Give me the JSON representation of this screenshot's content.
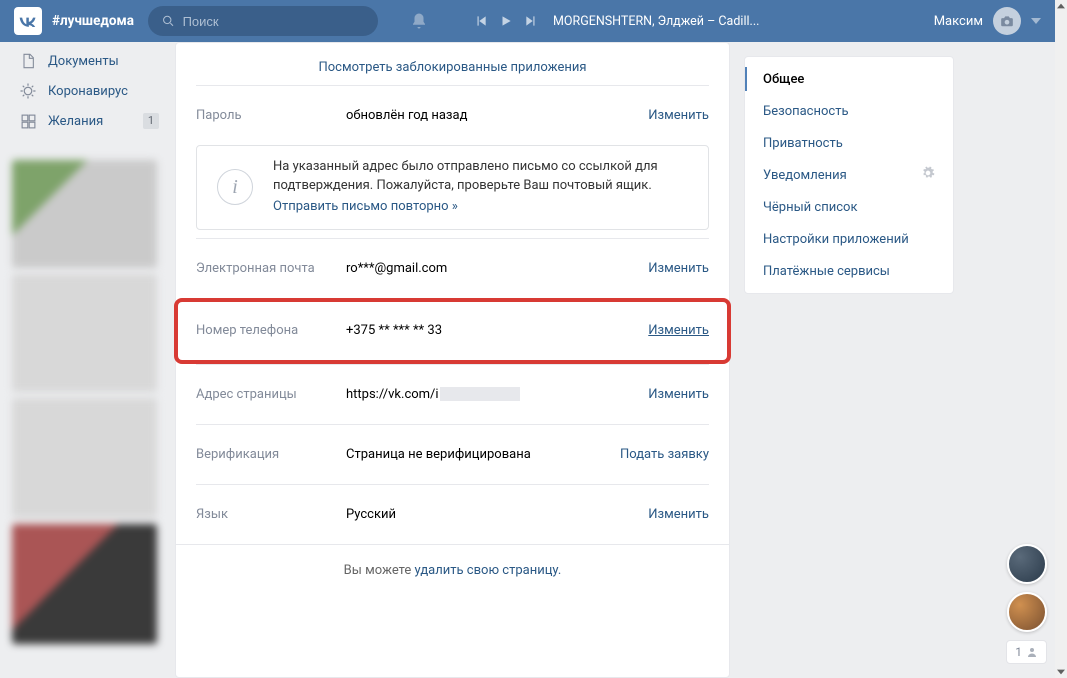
{
  "header": {
    "logo_tag": "#лучшедома",
    "search_placeholder": "Поиск",
    "track": "MORGENSHTERN, Элджей – Cadill...",
    "user_name": "Максим"
  },
  "sidebar": {
    "items": [
      {
        "label": "Документы"
      },
      {
        "label": "Коронавирус"
      },
      {
        "label": "Желания",
        "count": "1"
      }
    ]
  },
  "settings": {
    "linklist_label": "Посмотреть заблокированные приложения",
    "rows": {
      "password": {
        "label": "Пароль",
        "value": "обновлён год назад",
        "action": "Изменить"
      },
      "email": {
        "label": "Электронная почта",
        "value": "ro***@gmail.com",
        "action": "Изменить"
      },
      "phone": {
        "label": "Номер телефона",
        "value": "+375 ** *** ** 33",
        "action": "Изменить"
      },
      "address": {
        "label": "Адрес страницы",
        "value": "https://vk.com/i",
        "action": "Изменить"
      },
      "verify": {
        "label": "Верификация",
        "value": "Страница не верифицирована",
        "action": "Подать заявку"
      },
      "lang": {
        "label": "Язык",
        "value": "Русский",
        "action": "Изменить"
      }
    },
    "info_box": {
      "text1": "На указанный адрес было отправлено письмо со ссылкой для подтверждения. Пожалуйста, проверьте Ваш почтовый ящик.",
      "resend": "Отправить письмо повторно »"
    },
    "delete": {
      "pre": "Вы можете ",
      "link": "удалить свою страницу."
    }
  },
  "tabs": {
    "items": [
      "Общее",
      "Безопасность",
      "Приватность",
      "Уведомления",
      "Чёрный список",
      "Настройки приложений",
      "Платёжные сервисы"
    ]
  },
  "friends_widget": {
    "count": "1"
  }
}
